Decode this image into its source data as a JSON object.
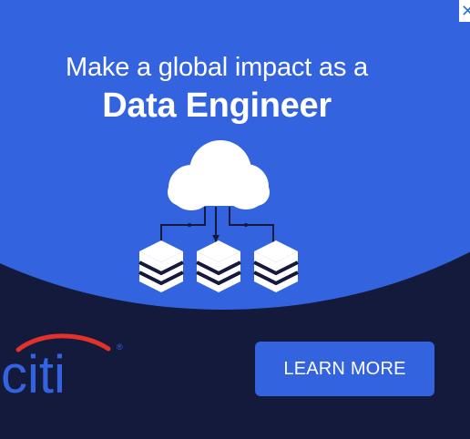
{
  "ad": {
    "headline_line1": "Make a global impact as a",
    "headline_line2": "Data Engineer",
    "cta_label": "LEARN MORE",
    "close_glyph": "✕"
  },
  "logo": {
    "text": "citi",
    "mark": "®"
  },
  "colors": {
    "background_navy": "#131a3c",
    "blue": "#3363df",
    "logo_red": "#e3322a",
    "white": "#ffffff"
  },
  "icons": [
    "cloud-icon",
    "database-icon",
    "arrow-icon"
  ]
}
